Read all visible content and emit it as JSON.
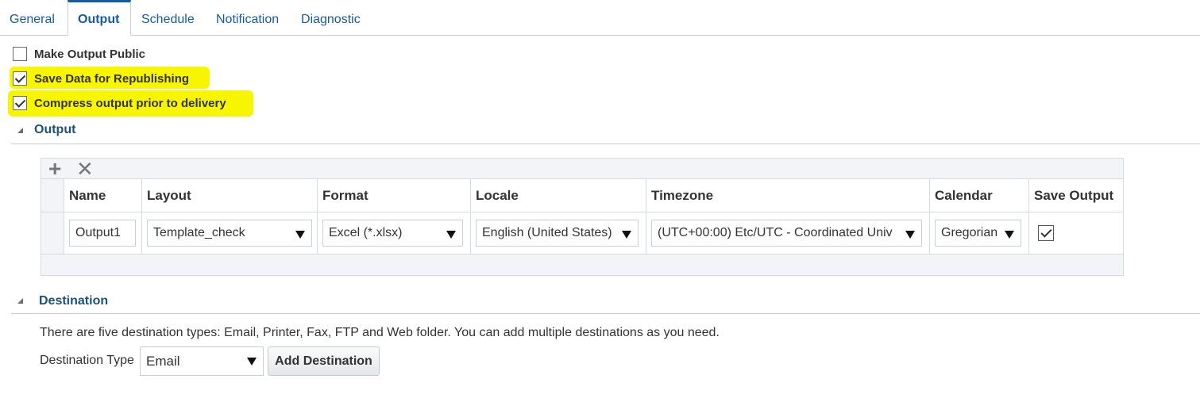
{
  "tabs": [
    {
      "label": "General"
    },
    {
      "label": "Output",
      "active": true
    },
    {
      "label": "Schedule"
    },
    {
      "label": "Notification"
    },
    {
      "label": "Diagnostic"
    }
  ],
  "options": {
    "make_public": {
      "label": "Make Output Public",
      "checked": false
    },
    "save_data": {
      "label": "Save Data for Republishing",
      "checked": true
    },
    "compress": {
      "label": "Compress output prior to delivery",
      "checked": true
    }
  },
  "output_section": {
    "title": "Output",
    "toolbar": {
      "add_icon": "plus-icon",
      "delete_icon": "x-icon"
    },
    "columns": [
      "Name",
      "Layout",
      "Format",
      "Locale",
      "Timezone",
      "Calendar",
      "Save Output"
    ],
    "rows": [
      {
        "name": "Output1",
        "layout": "Template_check",
        "format": "Excel (*.xlsx)",
        "locale": "English (United States)",
        "timezone": "(UTC+00:00) Etc/UTC - Coordinated Univ",
        "calendar": "Gregorian",
        "save_output": true
      }
    ]
  },
  "destination_section": {
    "title": "Destination",
    "description": "There are five destination types: Email, Printer, Fax, FTP and Web folder. You can add multiple destinations as you need.",
    "type_label": "Destination Type",
    "type_value": "Email",
    "add_button": "Add Destination"
  },
  "colors": {
    "tab_text": "#145c9e",
    "section_title": "#1d5178",
    "highlight": "#f7f500"
  }
}
